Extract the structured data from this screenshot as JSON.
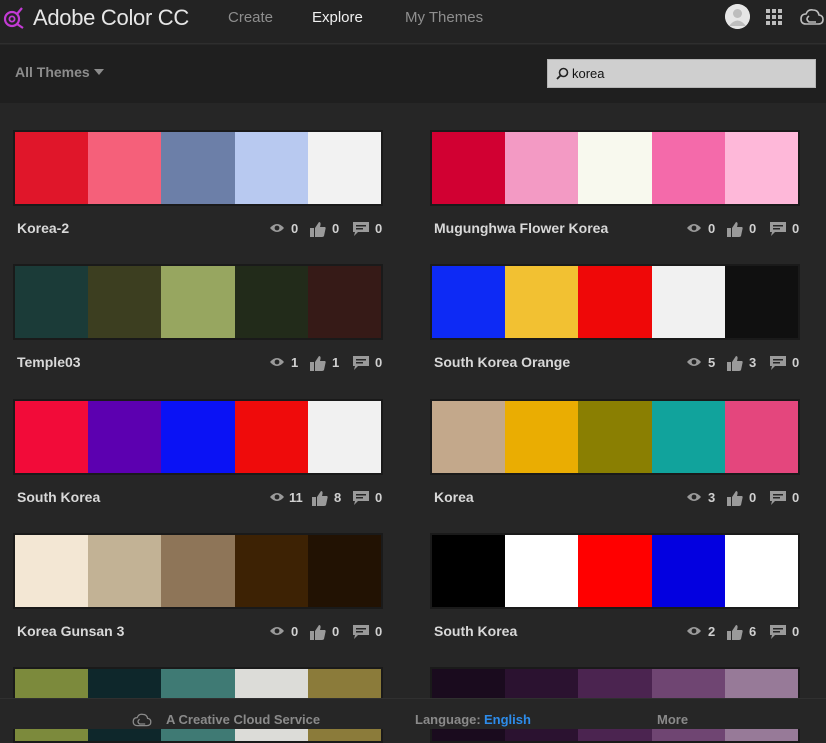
{
  "header": {
    "app_title": "Adobe Color CC",
    "nav": [
      {
        "label": "Create"
      },
      {
        "label": "Explore"
      },
      {
        "label": "My Themes"
      }
    ]
  },
  "toolbar": {
    "filter_label": "All Themes",
    "search_value": "korea",
    "search_placeholder": ""
  },
  "themes": [
    {
      "name": "Korea-2",
      "colors": [
        "#e0162a",
        "#f5607a",
        "#6c7fa8",
        "#b8c9f0",
        "#f2f2f2"
      ],
      "views": "0",
      "likes": "0",
      "comments": "0"
    },
    {
      "name": "Mugunghwa Flower Korea",
      "colors": [
        "#d10032",
        "#f39ac4",
        "#f8f9ee",
        "#f46aaa",
        "#feb8d9"
      ],
      "views": "0",
      "likes": "0",
      "comments": "0"
    },
    {
      "name": "Temple03",
      "colors": [
        "#1b3b38",
        "#3c3e20",
        "#97a660",
        "#222b1a",
        "#361a17"
      ],
      "views": "1",
      "likes": "1",
      "comments": "0"
    },
    {
      "name": "South Korea Orange",
      "colors": [
        "#0d2af5",
        "#f2c132",
        "#ef0808",
        "#f1f1f1",
        "#101010"
      ],
      "views": "5",
      "likes": "3",
      "comments": "0"
    },
    {
      "name": "South Korea",
      "colors": [
        "#f20b39",
        "#5c00b0",
        "#0a12f5",
        "#ef0b0b",
        "#f1f1f1"
      ],
      "views": "11",
      "likes": "8",
      "comments": "0"
    },
    {
      "name": "Korea",
      "colors": [
        "#c3a88b",
        "#eaad02",
        "#8a7f02",
        "#11a39c",
        "#e4467d"
      ],
      "views": "3",
      "likes": "0",
      "comments": "0"
    },
    {
      "name": "Korea Gunsan 3",
      "colors": [
        "#f3e7d4",
        "#c2b295",
        "#8e7558",
        "#3d2204",
        "#221203"
      ],
      "views": "0",
      "likes": "0",
      "comments": "0"
    },
    {
      "name": "South Korea",
      "colors": [
        "#000000",
        "#ffffff",
        "#ff0000",
        "#0300e0",
        "#ffffff"
      ],
      "views": "2",
      "likes": "6",
      "comments": "0"
    },
    {
      "name": "",
      "colors": [
        "#7c8a3c",
        "#0e272b",
        "#3f7a74",
        "#dcdcd8",
        "#8b7b3a"
      ],
      "views": "",
      "likes": "",
      "comments": ""
    },
    {
      "name": "",
      "colors": [
        "#1a0b1e",
        "#2b1230",
        "#4b2450",
        "#6f4572",
        "#977a98"
      ],
      "views": "",
      "likes": "",
      "comments": ""
    }
  ],
  "footer": {
    "service_text": "A Creative Cloud Service",
    "language_label": "Language:",
    "language_value": "English",
    "more_label": "More"
  },
  "icons": [
    "color-wheel-logo-icon",
    "avatar-icon",
    "apps-grid-icon",
    "creative-cloud-icon",
    "search-icon",
    "eye-icon",
    "thumbs-up-icon",
    "comment-icon"
  ]
}
